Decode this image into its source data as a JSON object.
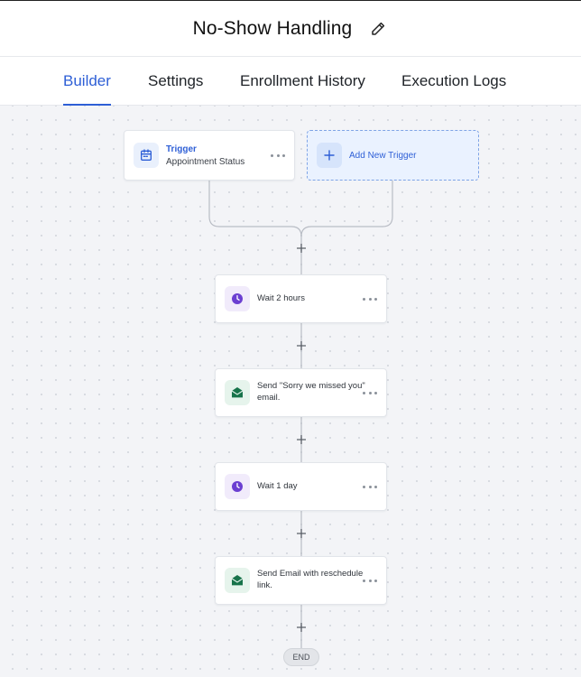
{
  "header": {
    "title": "No-Show Handling",
    "edit_icon": "pencil-icon"
  },
  "tabs": [
    {
      "label": "Builder",
      "active": true
    },
    {
      "label": "Settings",
      "active": false
    },
    {
      "label": "Enrollment History",
      "active": false
    },
    {
      "label": "Execution Logs",
      "active": false
    }
  ],
  "trigger": {
    "title": "Trigger",
    "subtitle": "Appointment Status",
    "icon": "calendar-icon"
  },
  "add_trigger": {
    "label": "Add New Trigger",
    "icon": "plus-icon"
  },
  "steps": [
    {
      "label": "Wait 2 hours",
      "icon": "clock-icon"
    },
    {
      "label": "Send \"Sorry we missed you\" email.",
      "icon": "envelope-icon"
    },
    {
      "label": "Wait 1 day",
      "icon": "clock-icon"
    },
    {
      "label": "Send Email with reschedule link.",
      "icon": "envelope-icon"
    }
  ],
  "end_label": "END",
  "colors": {
    "accent": "#2e5fd6",
    "wait_icon": "#6b3fd1",
    "email_icon": "#17734a"
  }
}
